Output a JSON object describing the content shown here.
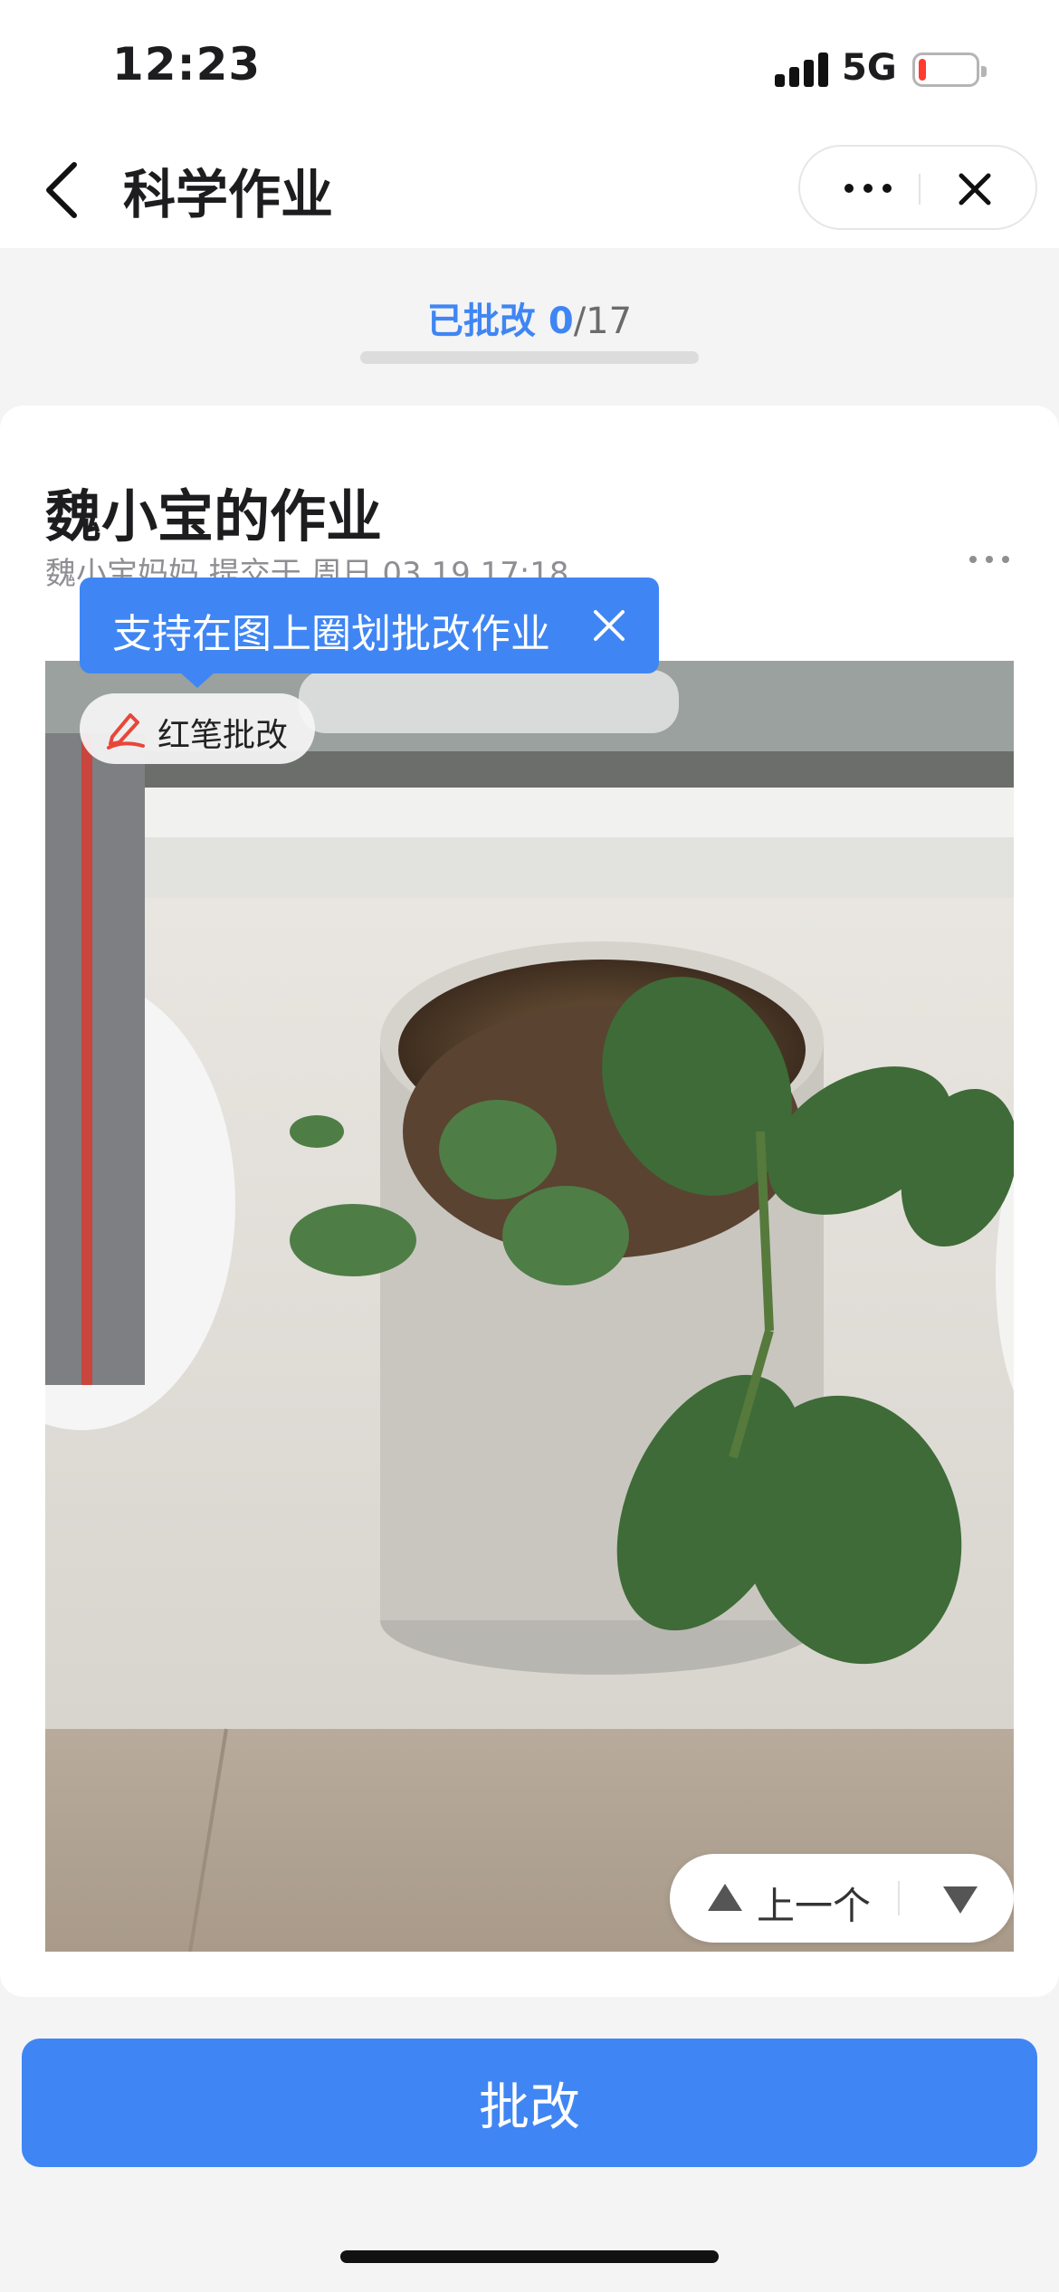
{
  "status_bar": {
    "time": "12:23",
    "network": "5G",
    "battery_level": 0.12
  },
  "nav": {
    "title": "科学作业",
    "back_icon": "chevron-left-icon",
    "more_icon": "more-horizontal-icon",
    "close_icon": "close-icon"
  },
  "progress": {
    "label": "已批改",
    "done": "0",
    "total": "/17",
    "fraction": 0.0
  },
  "homework": {
    "title": "魏小宝的作业",
    "meta": "魏小宝妈妈 提交于 周日 03.19 17:18",
    "more_icon": "more-horizontal-icon"
  },
  "tooltip": {
    "text": "支持在图上圈划批改作业",
    "close_icon": "close-icon"
  },
  "red_pen": {
    "label": "红笔批改",
    "icon": "pen-icon",
    "color": "#e8463a"
  },
  "pager": {
    "prev_label": "上一个",
    "up_icon": "triangle-up-icon",
    "down_icon": "triangle-down-icon"
  },
  "footer": {
    "grade_label": "批改"
  },
  "colors": {
    "accent": "#3f86f4",
    "background": "#f4f4f5",
    "card": "#ffffff"
  }
}
